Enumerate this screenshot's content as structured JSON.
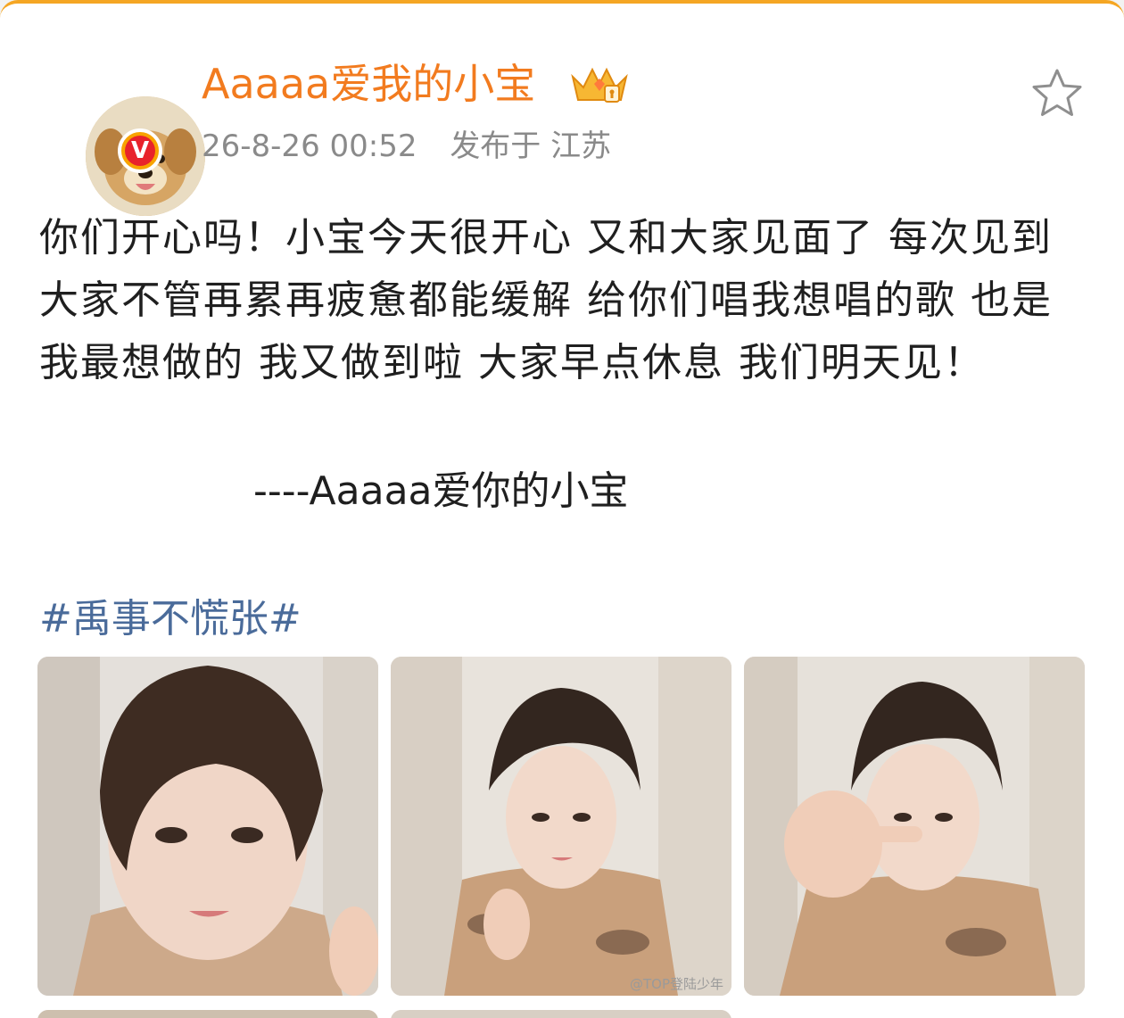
{
  "post": {
    "username": "Aaaaa爱我的小宝",
    "timestamp": "26-8-26 00:52",
    "published_label": "发布于 江苏",
    "body": "你们开心吗！小宝今天很开心 又和大家见面了 每次见到大家不管再累再疲惫都能缓解 给你们唱我想唱的歌 也是我最想做的 我又做到啦 大家早点休息 我们明天见！",
    "signature": "----Aaaaa爱你的小宝",
    "topic": "#禹事不慌张#",
    "verified_badge": "V",
    "watermark": "@TOP登陆少年"
  },
  "icons": {
    "favorite": "star-outline-icon",
    "member": "crown-badge-icon",
    "verified": "verified-v-icon"
  },
  "colors": {
    "username": "#f27b1f",
    "topic": "#4a6b9a",
    "accent_border": "#f5a623",
    "verified": "#e8232b"
  }
}
